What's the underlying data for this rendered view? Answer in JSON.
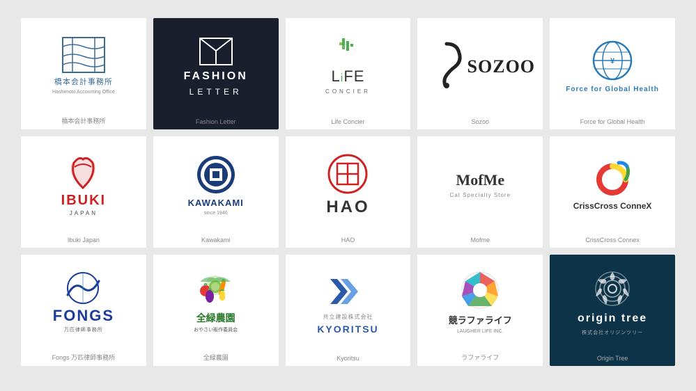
{
  "gallery": {
    "rows": [
      {
        "cards": [
          {
            "id": "hashimoto",
            "label": "橋本会計事務所",
            "bg": "white"
          },
          {
            "id": "fashion-letter",
            "label": "Fashion Letter",
            "bg": "dark"
          },
          {
            "id": "life-concier",
            "label": "Life Concier",
            "bg": "white"
          },
          {
            "id": "sozoo",
            "label": "Sozoo",
            "bg": "white"
          },
          {
            "id": "force-global",
            "label": "Force for Global Health",
            "bg": "white"
          }
        ]
      },
      {
        "cards": [
          {
            "id": "ibuki",
            "label": "Ibuki Japan",
            "bg": "white"
          },
          {
            "id": "kawakami",
            "label": "Kawakami",
            "bg": "white"
          },
          {
            "id": "hao",
            "label": "HAO",
            "bg": "white"
          },
          {
            "id": "mofme",
            "label": "Mofme",
            "bg": "white"
          },
          {
            "id": "crisscross",
            "label": "CrissCross Connex",
            "bg": "white"
          }
        ]
      },
      {
        "cards": [
          {
            "id": "fongs",
            "label": "Fongs 万匹律師事務所",
            "bg": "white"
          },
          {
            "id": "zenryoku",
            "label": "全緑農園",
            "bg": "white"
          },
          {
            "id": "kyoritsu",
            "label": "Kyoritsu",
            "bg": "white"
          },
          {
            "id": "laugher",
            "label": "ラファライフ",
            "bg": "white"
          },
          {
            "id": "origin-tree",
            "label": "Origin Tree",
            "bg": "teal"
          }
        ]
      }
    ]
  }
}
